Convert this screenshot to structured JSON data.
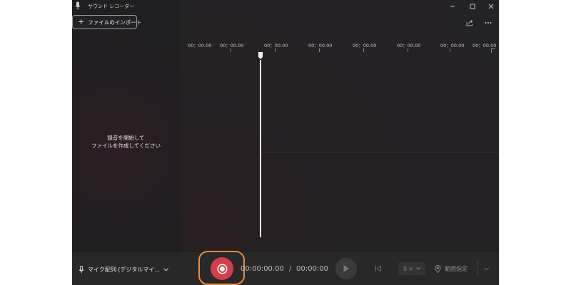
{
  "app": {
    "title": "サウンド レコーダー",
    "icon": "microphone-app-icon"
  },
  "toolbar": {
    "import_label": "ファイルのインポート",
    "import_icon": "plus-icon",
    "share_icon": "share-icon",
    "more_icon": "more-icon"
  },
  "window_controls": {
    "minimize_icon": "minimize-icon",
    "maximize_icon": "maximize-icon",
    "close_icon": "close-icon"
  },
  "sidebar": {
    "hint_line1": "録音を開始して",
    "hint_line2": "ファイルを作成してください"
  },
  "timeline": {
    "ticks": [
      "00：00.00",
      "00：00.00",
      "00：00.00",
      "00：00.00",
      "00：00.00",
      "00：00.00",
      "00：00.00",
      "00：00.00"
    ]
  },
  "bottom": {
    "mic_label": "マイク配列 (デジタルマイ...",
    "current_time": "00:00:00.00",
    "separator": "/",
    "total_time": "00:00:00",
    "speed_label": "0 ×",
    "range_label": "範囲指定"
  },
  "colors": {
    "record": "#d23e4a",
    "highlight": "#ee8a3c",
    "background": "#201f22"
  }
}
